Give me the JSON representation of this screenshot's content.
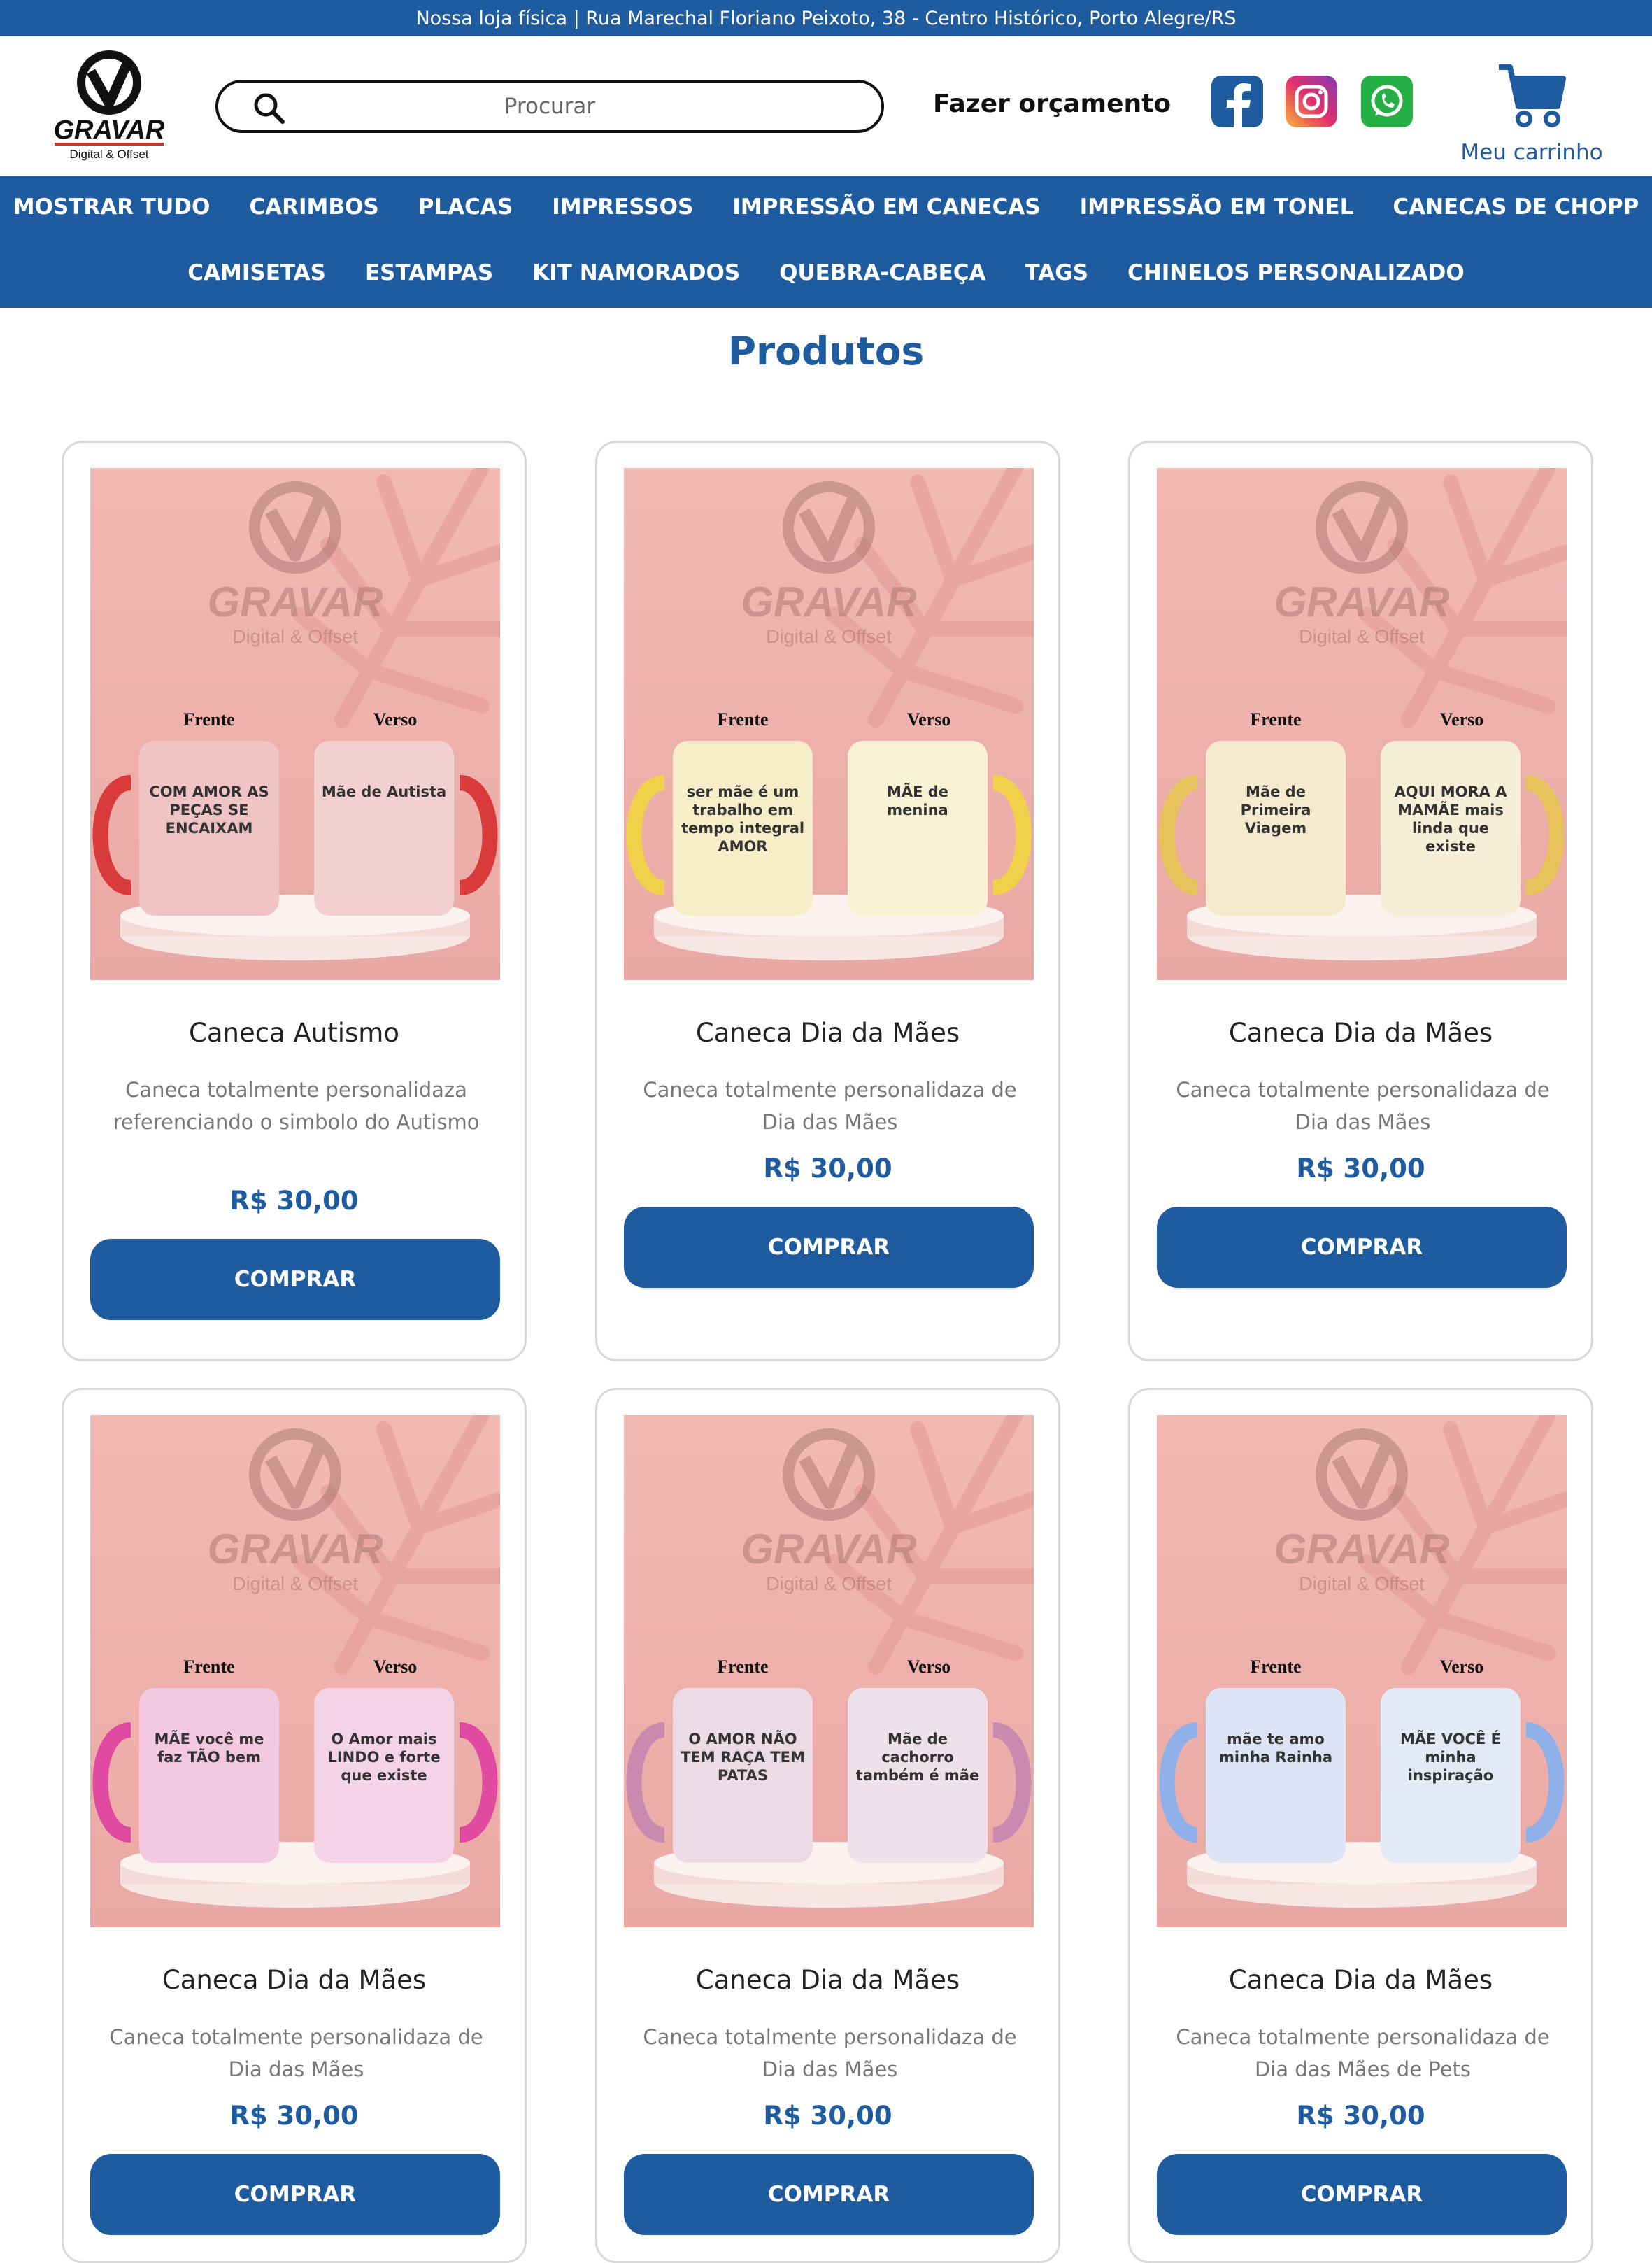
{
  "topbar": {
    "text": "Nossa loja física | Rua Marechal Floriano Peixoto, 38 - Centro Histórico, Porto Alegre/RS"
  },
  "header": {
    "logo": {
      "name": "GRAVAR",
      "tagline": "Digital & Offset"
    },
    "search_placeholder": "Procurar",
    "quote_label": "Fazer orçamento",
    "cart_label": "Meu carrinho",
    "social_icons": [
      "facebook-icon",
      "instagram-icon",
      "whatsapp-icon"
    ]
  },
  "nav": {
    "row1": [
      "MOSTRAR TUDO",
      "CARIMBOS",
      "PLACAS",
      "IMPRESSOS",
      "IMPRESSÃO EM CANECAS",
      "IMPRESSÃO EM TONEL",
      "CANECAS DE CHOPP"
    ],
    "row2": [
      "CAMISETAS",
      "ESTAMPAS",
      "KIT NAMORADOS",
      "QUEBRA-CABEÇA",
      "TAGS",
      "CHINELOS PERSONALIZADO"
    ]
  },
  "section_title": "Produtos",
  "products": [
    {
      "name": "Caneca Autismo",
      "desc": "Caneca totalmente personalidaza referenciando o simbolo do Autismo",
      "price": "R$ 30,00",
      "button": "COMPRAR",
      "image": {
        "watermark": "GRAVAR",
        "watermark_sub": "Digital & Offset",
        "front": "Frente",
        "back": "Verso",
        "mug1": "COM AMOR AS PEÇAS SE ENCAIXAM",
        "mug2": "Mãe de Autista",
        "accent": "#d93a3a"
      }
    },
    {
      "name": "Caneca Dia da Mães",
      "desc": "Caneca totalmente personalidaza de Dia das Mães",
      "price": "R$ 30,00",
      "button": "COMPRAR",
      "image": {
        "watermark": "GRAVAR",
        "watermark_sub": "Digital & Offset",
        "front": "Frente",
        "back": "Verso",
        "mug1": "ser mãe é um trabalho em tempo integral AMOR",
        "mug2": "MÃE de menina",
        "accent": "#f1d04a"
      }
    },
    {
      "name": "Caneca Dia da Mães",
      "desc": "Caneca totalmente personalidaza de Dia das Mães",
      "price": "R$ 30,00",
      "button": "COMPRAR",
      "image": {
        "watermark": "GRAVAR",
        "watermark_sub": "Digital & Offset",
        "front": "Frente",
        "back": "Verso",
        "mug1": "Mãe de Primeira Viagem",
        "mug2": "AQUI MORA A MAMÃE mais linda que existe",
        "accent": "#e8c25a"
      }
    },
    {
      "name": "Caneca Dia da Mães",
      "desc": "Caneca totalmente personalidaza de Dia das Mães",
      "price": "R$ 30,00",
      "button": "COMPRAR",
      "image": {
        "watermark": "GRAVAR",
        "watermark_sub": "Digital & Offset",
        "front": "Frente",
        "back": "Verso",
        "mug1": "MÃE você me faz TÃO bem",
        "mug2": "O Amor mais LINDO e forte que existe",
        "accent": "#e04aa0"
      }
    },
    {
      "name": "Caneca Dia da Mães",
      "desc": "Caneca totalmente personalidaza de Dia das Mães",
      "price": "R$ 30,00",
      "button": "COMPRAR",
      "image": {
        "watermark": "GRAVAR",
        "watermark_sub": "Digital & Offset",
        "front": "Frente",
        "back": "Verso",
        "mug1": "O AMOR NÃO TEM RAÇA TEM PATAS",
        "mug2": "Mãe de cachorro também é mãe",
        "accent": "#c98ab0"
      }
    },
    {
      "name": "Caneca Dia da Mães",
      "desc": "Caneca totalmente personalidaza de Dia das Mães de Pets",
      "price": "R$ 30,00",
      "button": "COMPRAR",
      "image": {
        "watermark": "GRAVAR",
        "watermark_sub": "Digital & Offset",
        "front": "Frente",
        "back": "Verso",
        "mug1": "mãe te amo minha Rainha",
        "mug2": "MÃE VOCÊ É minha inspiração",
        "accent": "#8fb0e8"
      }
    }
  ]
}
